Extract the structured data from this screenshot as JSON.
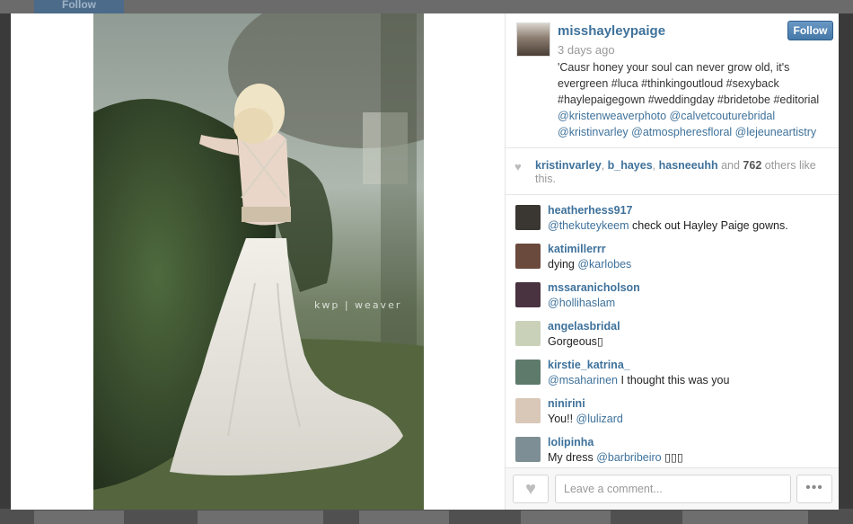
{
  "background": {
    "follow_label": "Follow"
  },
  "photo": {
    "watermark": "kwp | weaver"
  },
  "post": {
    "username": "misshayleypaige",
    "time": "3 days ago",
    "follow_label": "Follow",
    "caption_text": "'Causr honey your soul can never grow old, it's evergreen #luca #thinkingoutloud #sexyback #haylepaigegown #weddingday #bridetobe #editorial",
    "caption_mentions": "@kristenweaverphoto @calvetcouturebridal @kristinvarley @atmospheresfloral @lejeuneartistry"
  },
  "likes": {
    "heart_icon": "heart-icon",
    "user1": "kristinvarley",
    "sep1": ", ",
    "user2": "b_hayes",
    "sep2": ", ",
    "user3": "hasneeuhh",
    "and": " and ",
    "count": "762",
    "suffix": " others like this."
  },
  "comments": [
    {
      "user": "heatherhess917",
      "mention": "@thekuteykeem",
      "text": " check out Hayley Paige gowns.",
      "avatar_color": "#3a3632"
    },
    {
      "user": "katimillerrr",
      "mention": "",
      "text": "dying ",
      "mention_after": "@karlobes",
      "avatar_color": "#6a4a3d"
    },
    {
      "user": "mssaranicholson",
      "mention": "@hollihaslam",
      "text": "",
      "avatar_color": "#4a3340"
    },
    {
      "user": "angelasbridal",
      "mention": "",
      "text": "Gorgeous▯",
      "avatar_color": "#c9d2b9"
    },
    {
      "user": "kirstie_katrina_",
      "mention": "@msaharinen",
      "text": " I thought this was you",
      "avatar_color": "#5e7a6a"
    },
    {
      "user": "ninirini",
      "mention": "",
      "text": "You!! ",
      "mention_after": "@lulizard",
      "avatar_color": "#d9c7b8"
    },
    {
      "user": "lolipinha",
      "mention": "",
      "text": "My dress ",
      "mention_after": "@barbribeiro",
      "tail": " ▯▯▯",
      "avatar_color": "#7d8f95"
    }
  ],
  "footer": {
    "placeholder": "Leave a comment...",
    "more_label": "•••",
    "like_icon": "heart-icon"
  }
}
